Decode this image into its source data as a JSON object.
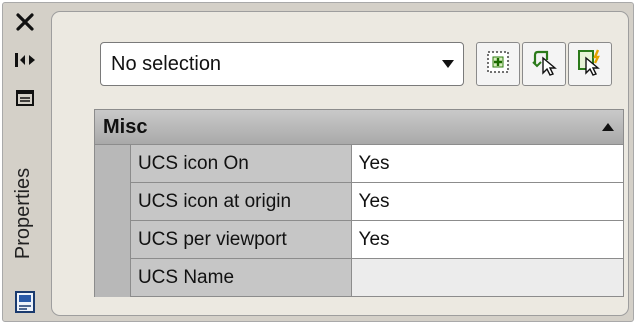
{
  "palette": {
    "title": "Properties",
    "close_icon": "close-icon",
    "autohide_icon": "auto-hide-icon",
    "menu_icon": "properties-menu-icon",
    "bottom_icon": "palette-settings-icon"
  },
  "selector": {
    "value": "No selection",
    "arrow_icon": "dropdown-arrow-icon"
  },
  "toolbar": {
    "toggle_pickadd_icon": "toggle-pickadd-icon",
    "select_objects_icon": "select-objects-icon",
    "quick_select_icon": "quick-select-icon"
  },
  "grid": {
    "category": "Misc",
    "collapse_icon": "collapse-triangle-icon",
    "rows": [
      {
        "name": "UCS icon On",
        "value": "Yes"
      },
      {
        "name": "UCS icon at origin",
        "value": "Yes"
      },
      {
        "name": "UCS per viewport",
        "value": "Yes"
      },
      {
        "name": "UCS Name",
        "value": ""
      }
    ]
  },
  "colors": {
    "panel": "#d4d0c8",
    "content": "#ece9e1",
    "category_bar": "#b5b5b5",
    "name_cell": "#c6c6c6"
  }
}
